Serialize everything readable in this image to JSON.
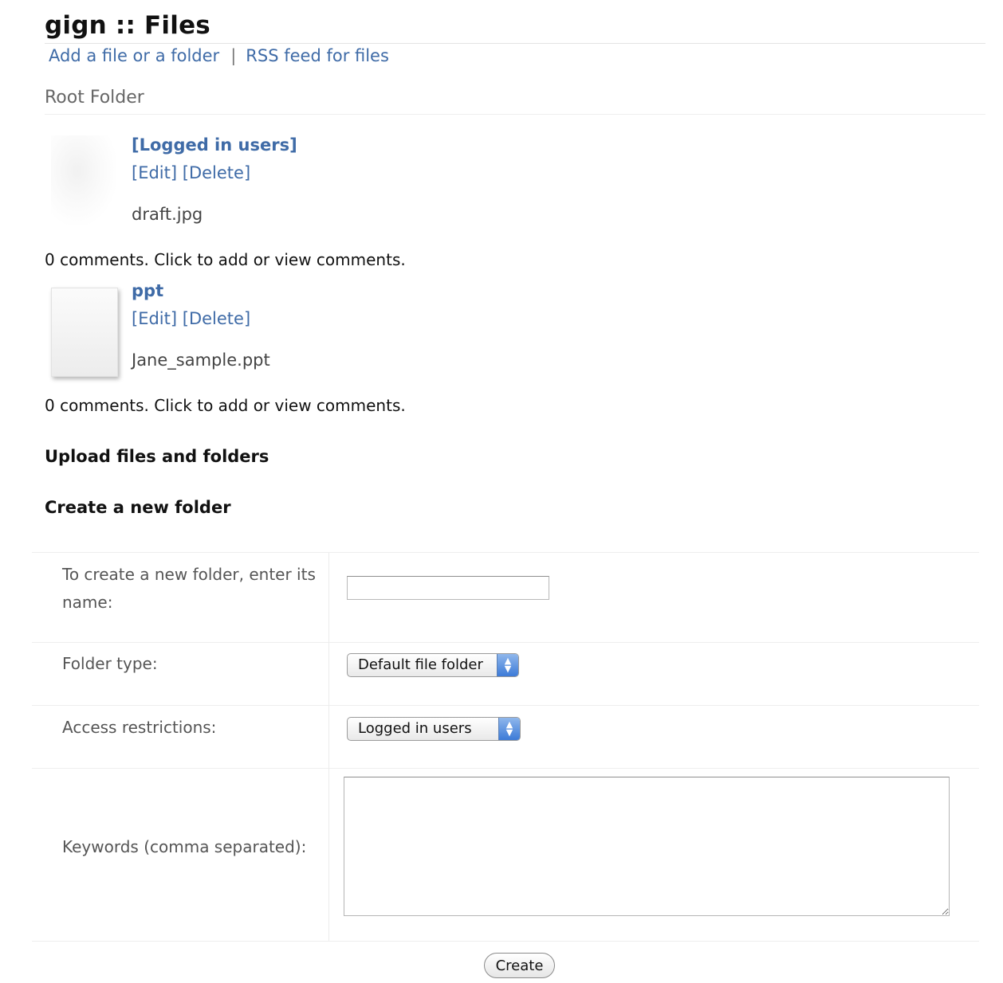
{
  "header": {
    "title": "gign :: Files",
    "links": [
      "Add a file or a folder",
      "RSS feed for files"
    ],
    "separator": "|"
  },
  "folder": {
    "label": "Root Folder"
  },
  "files": [
    {
      "title": "[Logged in users]",
      "edit": "[Edit]",
      "delete": "[Delete]",
      "filename": "draft.jpg",
      "comments": "0 comments. Click to add or view comments."
    },
    {
      "title": "ppt",
      "edit": "[Edit]",
      "delete": "[Delete]",
      "filename": "Jane_sample.ppt",
      "comments": "0 comments. Click to add or view comments."
    }
  ],
  "sections": {
    "upload": "Upload files and folders",
    "create": "Create a new folder"
  },
  "form": {
    "name_label": "To create a new folder, enter its name:",
    "name_value": "",
    "type_label": "Folder type:",
    "type_value": "Default file folder",
    "access_label": "Access restrictions:",
    "access_value": "Logged in users",
    "keywords_label": "Keywords (comma separated):",
    "keywords_value": "",
    "submit_label": "Create"
  },
  "colors": {
    "link": "#3f6ba7",
    "select_arrow": "#3c7ad7"
  },
  "icons": {
    "select_arrow": "up-down-arrows-icon",
    "thumbnail": "file-thumbnail-icon"
  }
}
